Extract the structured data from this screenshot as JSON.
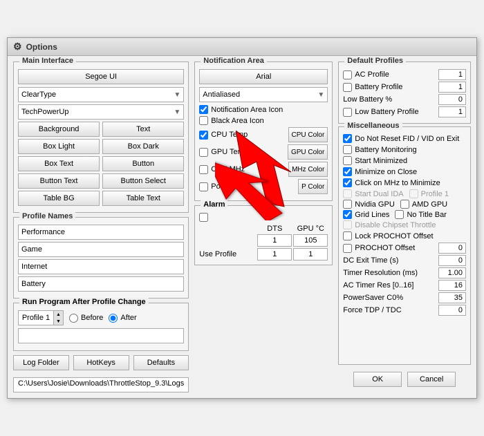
{
  "window": {
    "title": "Options"
  },
  "main_interface": {
    "label": "Main Interface",
    "font_btn": "Segoe UI",
    "cleartype_dropdown": "ClearType",
    "techpowerup_dropdown": "TechPowerUp",
    "btn_background": "Background",
    "btn_text": "Text",
    "btn_box_light": "Box Light",
    "btn_box_dark": "Box Dark",
    "btn_box_text": "Box Text",
    "btn_button": "Button",
    "btn_button_text": "Button Text",
    "btn_button_select": "Button Select",
    "btn_table_bg": "Table BG",
    "btn_table_text": "Table Text"
  },
  "profile_names": {
    "label": "Profile Names",
    "profiles": [
      "Performance",
      "Game",
      "Internet",
      "Battery"
    ]
  },
  "run_program": {
    "label": "Run Program After Profile Change",
    "profile_value": "Profile 1",
    "before_label": "Before",
    "after_label": "After",
    "after_checked": true
  },
  "bottom_buttons": {
    "log_folder": "Log Folder",
    "hotkeys": "HotKeys",
    "defaults": "Defaults"
  },
  "status_bar": {
    "text": "C:\\Users\\Josie\\Downloads\\ThrottleStop_9.3\\Logs"
  },
  "notification_area": {
    "label": "Notification Area",
    "font_btn": "Arial",
    "antialiased_dropdown": "Antialiased",
    "notif_area_icon": {
      "label": "Notification Area Icon",
      "checked": true
    },
    "black_area_icon": {
      "label": "Black Area Icon",
      "checked": false
    },
    "cpu_temp": {
      "label": "CPU Temp",
      "checked": true
    },
    "cpu_color_btn": "CPU Color",
    "gpu_temp": {
      "label": "GPU Temp",
      "checked": false
    },
    "gpu_color_btn": "GPU Color",
    "cpu_mhz": {
      "label": "CPU MHz",
      "checked": false
    },
    "mhz_color_btn": "MHz Color",
    "power": {
      "label": "Power",
      "checked": false
    },
    "power_color_btn": "P Color"
  },
  "alarm": {
    "label": "Alarm",
    "checked": false,
    "col_dts": "DTS",
    "col_gpu": "GPU °C",
    "row1": {
      "label": "",
      "dts": "1",
      "gpu": "105"
    },
    "use_profile_label": "Use Profile",
    "use_profile_dts": "1",
    "use_profile_gpu": "1"
  },
  "default_profiles": {
    "label": "Default Profiles",
    "ac_profile": {
      "label": "AC Profile",
      "checked": false,
      "value": "1"
    },
    "battery_profile": {
      "label": "Battery Profile",
      "checked": false,
      "value": "1"
    },
    "low_battery_pct": {
      "label": "Low Battery %",
      "value": "0"
    },
    "low_battery_profile": {
      "label": "Low Battery Profile",
      "checked": false,
      "value": "1"
    }
  },
  "miscellaneous": {
    "label": "Miscellaneous",
    "do_not_reset_fid": {
      "label": "Do Not Reset FID / VID on Exit",
      "checked": true
    },
    "battery_monitoring": {
      "label": "Battery Monitoring",
      "checked": false
    },
    "start_minimized": {
      "label": "Start Minimized",
      "checked": false
    },
    "minimize_on_close": {
      "label": "Minimize on Close",
      "checked": true
    },
    "click_on_mhz": {
      "label": "Click on MHz to Minimize",
      "checked": true
    },
    "start_dual_ida": {
      "label": "Start Dual IDA",
      "checked": false
    },
    "profile_1": {
      "label": "Profile 1",
      "checked": false
    },
    "nvidia_gpu": {
      "label": "Nvidia GPU",
      "checked": false
    },
    "amd_gpu": {
      "label": "AMD GPU",
      "checked": false
    },
    "grid_lines": {
      "label": "Grid Lines",
      "checked": true
    },
    "no_title_bar": {
      "label": "No Title Bar",
      "checked": false
    },
    "disable_chipset_throttle": {
      "label": "Disable Chipset Throttle",
      "checked": false
    },
    "lock_prochot_offset": {
      "label": "Lock PROCHOT Offset",
      "checked": false
    },
    "prochot_offset": {
      "label": "PROCHOT Offset",
      "checked": false,
      "value": "0"
    },
    "dc_exit_time": {
      "label": "DC Exit Time (s)",
      "value": "0"
    },
    "timer_resolution": {
      "label": "Timer Resolution (ms)",
      "value": "1.00"
    },
    "ac_timer_res": {
      "label": "AC Timer Res [0..16]",
      "value": "16"
    },
    "powersaver_c0": {
      "label": "PowerSaver C0%",
      "value": "35"
    },
    "force_tdp_tdc": {
      "label": "Force TDP / TDC",
      "value": "0"
    }
  },
  "dialog_buttons": {
    "ok": "OK",
    "cancel": "Cancel"
  }
}
